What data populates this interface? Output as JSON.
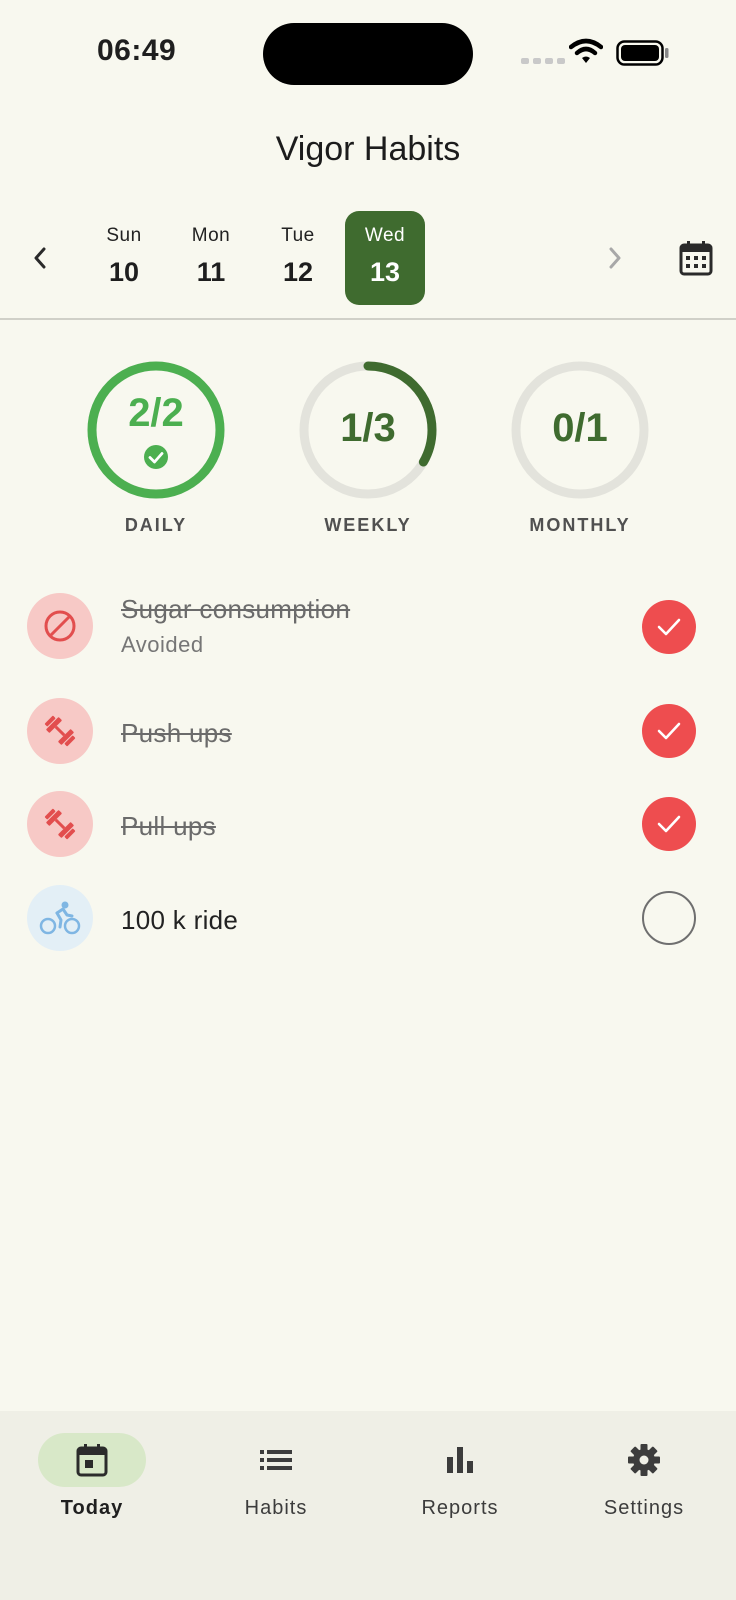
{
  "status_bar": {
    "time": "06:49"
  },
  "app": {
    "title": "Vigor Habits"
  },
  "date_strip": {
    "days": [
      {
        "name": "Sun",
        "date": "10",
        "selected": false
      },
      {
        "name": "Mon",
        "date": "11",
        "selected": false
      },
      {
        "name": "Tue",
        "date": "12",
        "selected": false
      },
      {
        "name": "Wed",
        "date": "13",
        "selected": true
      }
    ]
  },
  "progress": [
    {
      "value": "2/2",
      "label": "DAILY",
      "done": 2,
      "total": 2,
      "color": "#4caf50"
    },
    {
      "value": "1/3",
      "label": "WEEKLY",
      "done": 1,
      "total": 3,
      "color": "#3f6b2f"
    },
    {
      "value": "0/1",
      "label": "MONTHLY",
      "done": 0,
      "total": 1,
      "color": "#3f6b2f"
    }
  ],
  "habits": [
    {
      "name": "Sugar consumption",
      "subtitle": "Avoided",
      "icon": "block-icon",
      "completed": true
    },
    {
      "name": "Push ups",
      "subtitle": "",
      "icon": "dumbbell-icon",
      "completed": true
    },
    {
      "name": "Pull ups",
      "subtitle": "",
      "icon": "dumbbell-icon",
      "completed": true
    },
    {
      "name": "100 k ride",
      "subtitle": "",
      "icon": "bike-icon",
      "completed": false
    }
  ],
  "bottom_nav": {
    "items": [
      {
        "label": "Today",
        "icon": "calendar-today-icon",
        "active": true
      },
      {
        "label": "Habits",
        "icon": "list-icon",
        "active": false
      },
      {
        "label": "Reports",
        "icon": "bar-chart-icon",
        "active": false
      },
      {
        "label": "Settings",
        "icon": "gear-icon",
        "active": false
      }
    ]
  },
  "colors": {
    "accent": "#3f6b2f",
    "success": "#4caf50",
    "done_red": "#ee4d4f",
    "background": "#f8f8ef"
  }
}
